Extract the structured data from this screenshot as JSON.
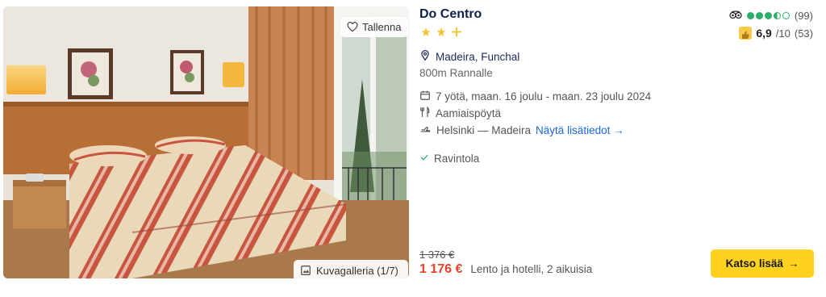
{
  "photo": {
    "save_label": "Tallenna",
    "gallery_label": "Kuvagalleria (1/7)"
  },
  "hotel": {
    "name": "Do Centro",
    "stars": {
      "full": 2,
      "plus": 1
    },
    "location": "Madeira, Funchal",
    "beach_distance": "800m Rannalle"
  },
  "reviews": {
    "tripadvisor_dots": {
      "full": 3,
      "half": 1,
      "empty": 1
    },
    "tripadvisor_count": "(99)",
    "score": "6,9",
    "score_scale": "/10",
    "score_count": "(53)"
  },
  "trip": {
    "dates": "7 yötä, maan. 16 joulu - maan. 23 joulu 2024",
    "board": "Aamiaispöytä",
    "flight": "Helsinki — Madeira",
    "more_link": "Näytä lisätiedot"
  },
  "facility": "Ravintola",
  "pricing": {
    "old_price": "1 376 €",
    "price": "1 176 €",
    "price_note": "Lento ja hotelli, 2 aikuisia"
  },
  "cta": {
    "label": "Katso lisää",
    "arrow": "→"
  },
  "colors": {
    "title": "#0e2049",
    "price": "#e8412c",
    "cta": "#ffd21f",
    "link": "#1d66d6",
    "stars": "#f1c232",
    "tripadvisor": "#2bad6b"
  }
}
